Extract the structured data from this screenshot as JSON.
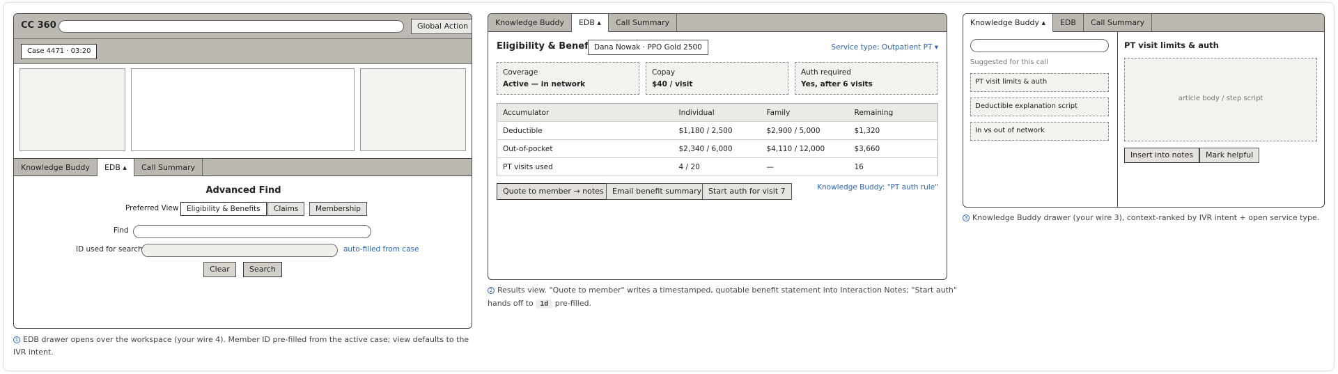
{
  "panel1": {
    "app_title": "CC 360",
    "global_action": "Global Action",
    "case_badge": "Case 4471 · 03:20",
    "tabs": [
      "Knowledge Buddy",
      "EDB ▴",
      "Call Summary"
    ],
    "adv_find_title": "Advanced Find",
    "preferred_view_label": "Preferred View",
    "views": [
      "Eligibility & Benefits",
      "Claims",
      "Membership"
    ],
    "find_label": "Find",
    "id_label": "ID used for search",
    "autofill_note": "auto-filled from case",
    "clear": "Clear",
    "search": "Search"
  },
  "caption1": "EDB drawer opens over the workspace (your wire 4). Member ID pre-filled from the active case; view defaults to the IVR intent.",
  "caption1_num": "1",
  "panel2": {
    "tabs": [
      "Knowledge Buddy",
      "EDB ▴",
      "Call Summary"
    ],
    "title": "Eligibility & Benefits",
    "member": "Dana Nowak · PPO Gold 2500",
    "service_type": "Service type: Outpatient PT ▾",
    "cards": [
      {
        "label": "Coverage",
        "value": "Active — in network"
      },
      {
        "label": "Copay",
        "value": "$40 / visit"
      },
      {
        "label": "Auth required",
        "value": "Yes, after 6 visits"
      }
    ],
    "table_headers": [
      "Accumulator",
      "Individual",
      "Family",
      "Remaining"
    ],
    "rows": [
      [
        "Deductible",
        "$1,180 / 2,500",
        "$2,900 / 5,000",
        "$1,320"
      ],
      [
        "Out-of-pocket",
        "$2,340 / 6,000",
        "$4,110 / 12,000",
        "$3,660"
      ],
      [
        "PT visits used",
        "4 / 20",
        "—",
        "16"
      ]
    ],
    "quote_btn": "Quote to member → notes",
    "email_btn": "Email benefit summary",
    "auth_btn": "Start auth for visit 7",
    "kb_link": "Knowledge Buddy: \"PT auth rule\""
  },
  "caption2": {
    "num": "2",
    "line1": "Results view. \"Quote to member\" writes a timestamped, quotable benefit statement into Interaction Notes; \"Start auth\"",
    "line2a": "hands off to",
    "code": "1d",
    "line2b": "pre-filled."
  },
  "panel3": {
    "tabs": [
      "Knowledge Buddy ▴",
      "EDB",
      "Call Summary"
    ],
    "suggested_label": "Suggested for this call",
    "suggestions": [
      "PT visit limits & auth",
      "Deductible explanation script",
      "In vs out of network"
    ],
    "article_title": "PT visit limits & auth",
    "article_body": "article body / step script",
    "insert_btn": "Insert into notes",
    "helpful_btn": "Mark helpful"
  },
  "caption3": {
    "num": "3",
    "text": "Knowledge Buddy drawer (your wire 3), context-ranked by IVR intent + open service type."
  }
}
